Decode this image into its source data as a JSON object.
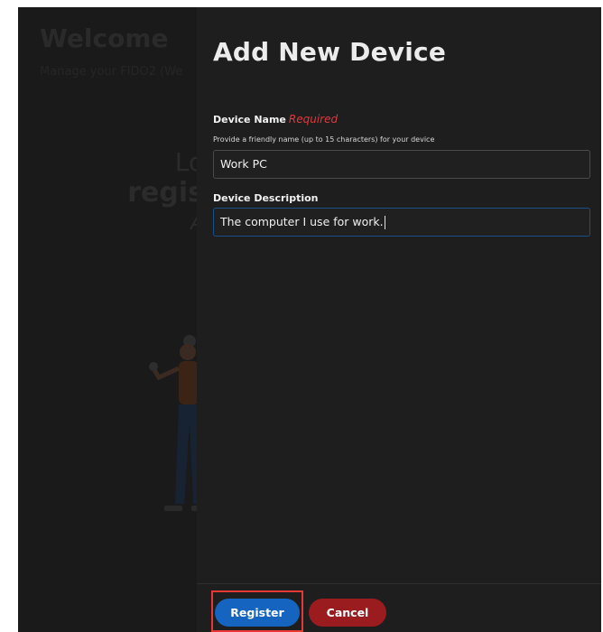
{
  "background": {
    "welcome": "Welcome",
    "subtitle": "Manage your FIDO2 (We",
    "hero": {
      "line1": "Lo",
      "line2": "regis",
      "line3": "A"
    }
  },
  "panel": {
    "title": "Add New Device",
    "device_name": {
      "label": "Device Name",
      "required": "Required",
      "help": "Provide a friendly name (up to 15 characters) for your device",
      "value": "Work PC"
    },
    "device_description": {
      "label": "Device Description",
      "value": "The computer I use for work."
    },
    "buttons": {
      "register": "Register",
      "cancel": "Cancel"
    }
  },
  "colors": {
    "primary": "#1565c0",
    "danger": "#9b1c1f",
    "required": "#e0393e",
    "highlight": "#e53935"
  }
}
